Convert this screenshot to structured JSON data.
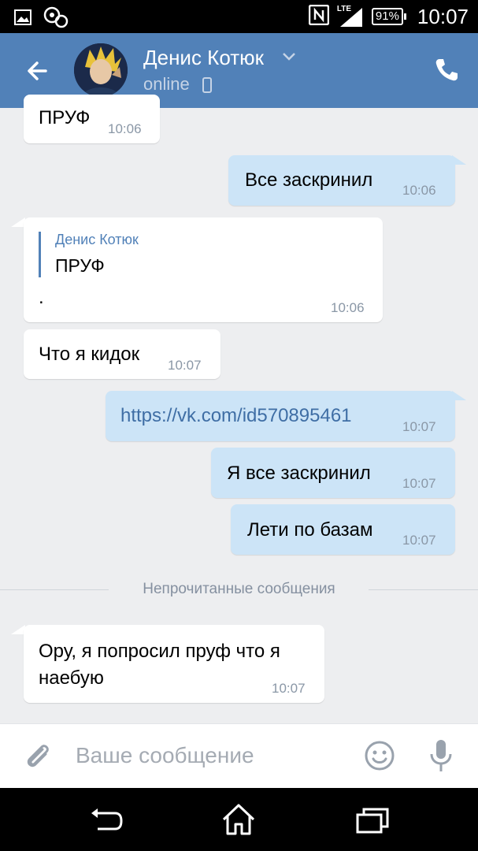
{
  "status_bar": {
    "battery": "91%",
    "network": "LTE",
    "time": "10:07"
  },
  "header": {
    "contact_name": "Денис Котюк",
    "status": "online"
  },
  "messages": [
    {
      "dir": "in",
      "text": "ПРУФ",
      "time": "10:06"
    },
    {
      "dir": "out",
      "text": "Все заскринил",
      "time": "10:06"
    },
    {
      "dir": "in",
      "quote_author": "Денис Котюк",
      "quote_text": "ПРУФ",
      "text": ".",
      "time": "10:06"
    },
    {
      "dir": "in",
      "text": "Что я кидок",
      "time": "10:07"
    },
    {
      "dir": "out",
      "text": "https://vk.com/id570895461",
      "time": "10:07"
    },
    {
      "dir": "out",
      "text": "Я все заскринил",
      "time": "10:07"
    },
    {
      "dir": "out",
      "text": "Лети по базам",
      "time": "10:07"
    },
    {
      "dir": "in",
      "text_line1": "Ору, я попросил пруф что я",
      "text_line2": "наебую",
      "time": "10:07"
    }
  ],
  "unread_separator": "Непрочитанные сообщения",
  "composer": {
    "placeholder": "Ваше сообщение"
  },
  "colors": {
    "header": "#5181b8",
    "background": "#edeef0",
    "outgoing_bubble": "#cce4f7",
    "incoming_bubble": "#ffffff"
  },
  "icons": {
    "back": "arrow-left-icon",
    "call": "phone-icon",
    "attach": "paperclip-icon",
    "emoji": "smile-icon",
    "voice": "microphone-icon"
  }
}
